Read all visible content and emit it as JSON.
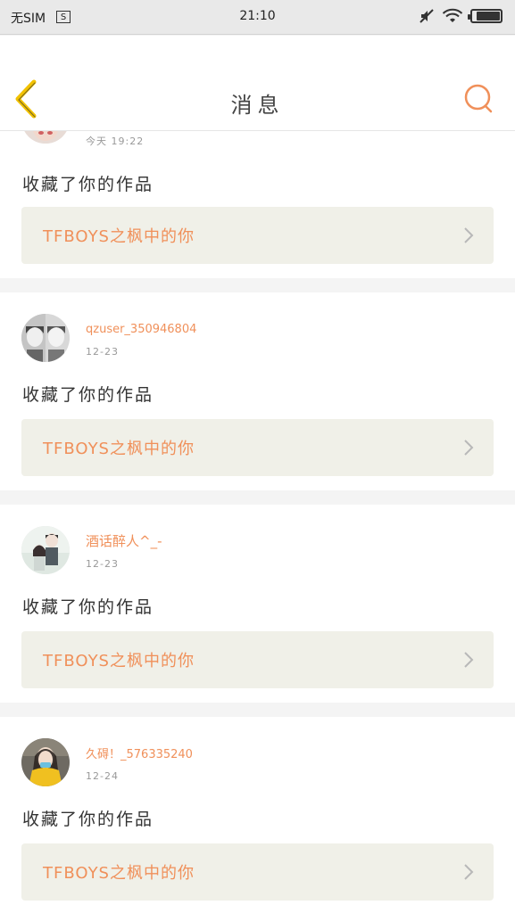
{
  "status_bar": {
    "carrier": "无SIM",
    "sim_icon_letter": "S",
    "time": "21:10",
    "icons": [
      "mute-icon",
      "wifi-icon",
      "battery-icon"
    ]
  },
  "header": {
    "title": "消息",
    "back_icon": "chevron-left-icon",
    "search_icon": "search-icon",
    "accent_color": "#f0905a",
    "back_color": "#f2c200"
  },
  "messages": [
    {
      "username": "",
      "time": "今天 19:22",
      "action": "收藏了你的作品",
      "work_title": "TFBOYS之枫中的你"
    },
    {
      "username": "qzuser_350946804",
      "time": "12-23",
      "action": "收藏了你的作品",
      "work_title": "TFBOYS之枫中的你"
    },
    {
      "username": "酒话醉人^_-",
      "time": "12-23",
      "action": "收藏了你的作品",
      "work_title": "TFBOYS之枫中的你"
    },
    {
      "username": "久碍！_576335240",
      "time": "12-24",
      "action": "收藏了你的作品",
      "work_title": "TFBOYS之枫中的你"
    }
  ]
}
